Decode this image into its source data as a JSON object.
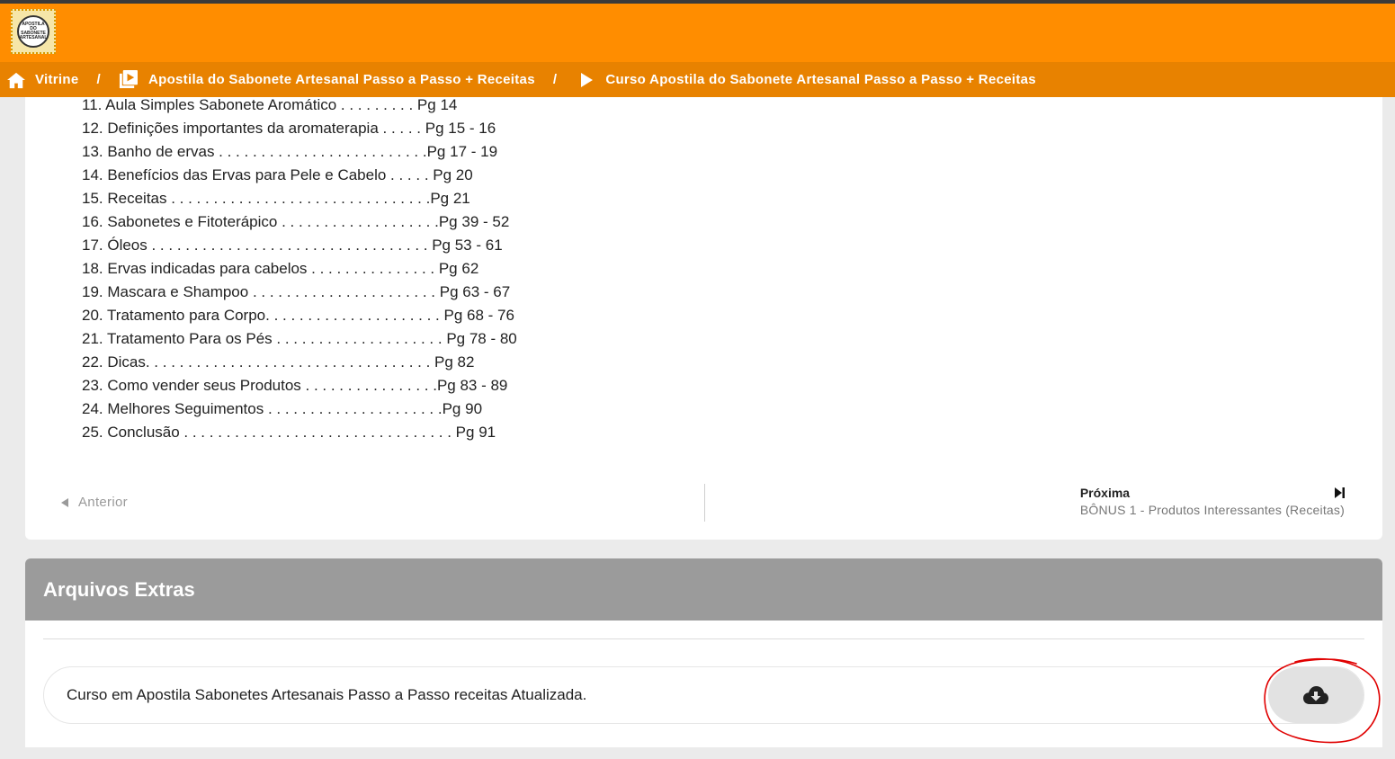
{
  "header": {
    "logo_lines": [
      "APOSTILA",
      "DO SABONETE",
      "ARTESANAL"
    ]
  },
  "breadcrumb": {
    "home_label": "Vitrine",
    "product_label": "Apostila do Sabonete Artesanal Passo a Passo + Receitas",
    "course_label": "Curso Apostila do Sabonete Artesanal Passo a Passo + Receitas",
    "separator": "/"
  },
  "toc": [
    "11. Aula Simples Sabonete Aromático . . . . . . . . . Pg 14",
    "12. Definições importantes da aromaterapia . . . . . Pg 15 - 16",
    "13. Banho de ervas . . . . . . . . . . . . . . . . . . . . . . . . .Pg 17 - 19",
    "14. Benefícios das Ervas para Pele e Cabelo . . . . . Pg 20",
    "15. Receitas . . . . . . . . . . . . . . . . . . . . . . . . . . . . . . .Pg 21",
    "16. Sabonetes e Fitoterápico . . . . . . . . . . . . . . . . . . .Pg 39 - 52",
    "17. Óleos . . . . . . . . . . . . . . . . . . . . . . . . . . . . . . . . . Pg 53 - 61",
    "18. Ervas indicadas para cabelos . . . . . . . . . . . . . . . Pg 62",
    "19. Mascara e Shampoo . . . . . . . . . . . . . . . . . . . . . . Pg 63 - 67",
    "20. Tratamento para Corpo. . . . . . . . . . . . . . . . . . . . . Pg 68 - 76",
    "21. Tratamento Para os Pés . . . . . . . . . . . . . . . . . . . . Pg 78 - 80",
    "22. Dicas. . . . . . . . . . . . . . . . . . . . . . . . . . . . . . . . . . Pg 82",
    "23. Como vender seus Produtos . . . . . . . . . . . . . . . .Pg 83 - 89",
    "24. Melhores Seguimentos . . . . . . . . . . . . . . . . . . . . .Pg 90",
    "25. Conclusão . . . . . . . . . . . . . . . . . . . . . . . . . . . . . . . . Pg 91"
  ],
  "nav": {
    "previous_label": "Anterior",
    "next_label": "Próxima",
    "next_lesson": "BÔNUS 1 - Produtos Interessantes (Receitas)"
  },
  "extras": {
    "title": "Arquivos Extras",
    "files": [
      {
        "name": "Curso em Apostila Sabonetes Artesanais Passo a Passo receitas Atualizada."
      }
    ]
  },
  "colors": {
    "header_orange": "#ff8d00",
    "breadcrumb_orange": "#e88200",
    "extras_header_gray": "#9b9b9b",
    "annotation_red": "#e00000"
  },
  "icons": {
    "home": "home-icon",
    "product": "video-library-icon",
    "course": "play-icon",
    "previous": "caret-left-icon",
    "next": "skip-next-icon",
    "download": "cloud-download-icon"
  }
}
